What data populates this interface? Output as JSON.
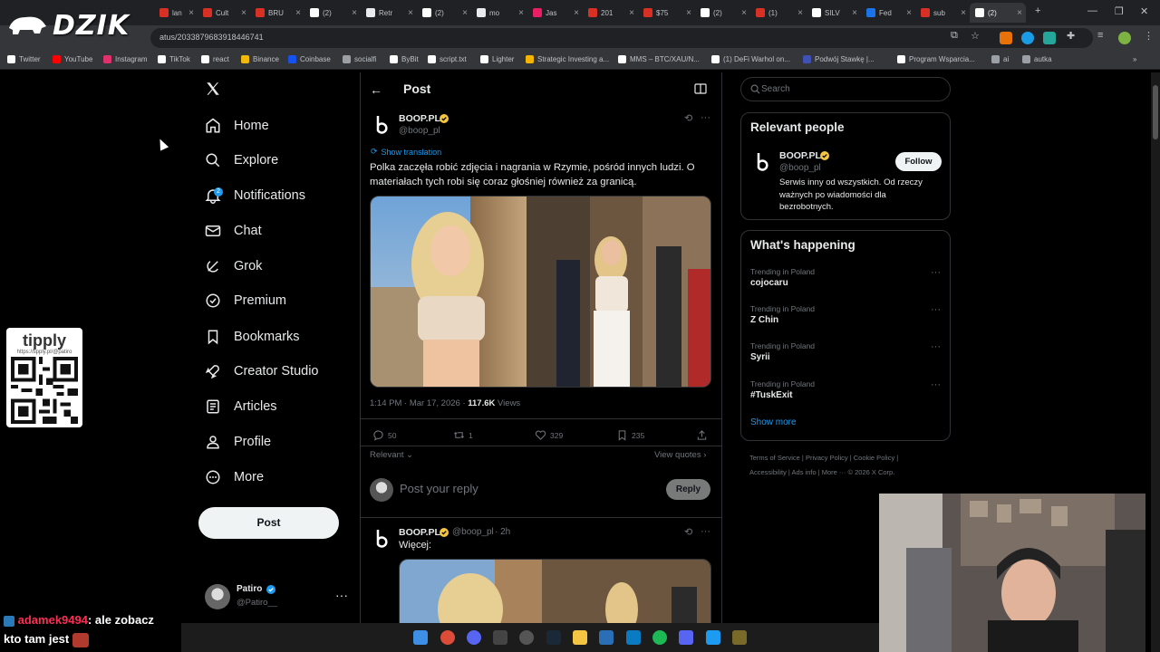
{
  "browser": {
    "tabs": [
      {
        "label": "lan",
        "color": "#d93025"
      },
      {
        "label": "Cult",
        "color": "#d93025"
      },
      {
        "label": "BRU",
        "color": "#d93025"
      },
      {
        "label": "(2)",
        "color": "#ffffff"
      },
      {
        "label": "Retr",
        "color": "#e8eaed"
      },
      {
        "label": "(2)",
        "color": "#ffffff"
      },
      {
        "label": "mo",
        "color": "#e8eaed"
      },
      {
        "label": "Jas",
        "color": "#e91e63"
      },
      {
        "label": "201",
        "color": "#d93025"
      },
      {
        "label": "$75",
        "color": "#d93025"
      },
      {
        "label": "(2)",
        "color": "#ffffff"
      },
      {
        "label": "(1)",
        "color": "#d93025"
      },
      {
        "label": "SILV",
        "color": "#ffffff"
      },
      {
        "label": "Fed",
        "color": "#1a73e8"
      },
      {
        "label": "sub",
        "color": "#d93025"
      },
      {
        "label": "(2)",
        "color": "#ffffff"
      }
    ],
    "url": "atus/2033879683918446741",
    "bookmarks": [
      {
        "label": "Twitter",
        "color": "#ffffff"
      },
      {
        "label": "YouTube",
        "color": "#ff0000"
      },
      {
        "label": "Instagram",
        "color": "#e1306c"
      },
      {
        "label": "TikTok",
        "color": "#ffffff"
      },
      {
        "label": "react",
        "color": "#ffffff"
      },
      {
        "label": "Binance",
        "color": "#f0b90b"
      },
      {
        "label": "Coinbase",
        "color": "#1652f0"
      },
      {
        "label": "socialfi",
        "color": "#9aa0a6"
      },
      {
        "label": "ByBit",
        "color": "#ffffff"
      },
      {
        "label": "script.txt",
        "color": "#ffffff"
      },
      {
        "label": "Lighter",
        "color": "#ffffff"
      },
      {
        "label": "Strategic Investing a...",
        "color": "#f4b400"
      },
      {
        "label": "MMS – BTC/XAU/N...",
        "color": "#ffffff"
      },
      {
        "label": "(1) DeFi Warhol on...",
        "color": "#ffffff"
      },
      {
        "label": "Podwój Stawkę |...",
        "color": "#3f51b5"
      },
      {
        "label": "Program Wsparcia...",
        "color": "#ffffff"
      },
      {
        "label": "ai",
        "color": "#9aa0a6"
      },
      {
        "label": "autka",
        "color": "#9aa0a6"
      }
    ]
  },
  "overlay": {
    "brand": "DZIK",
    "tipply_name": "tipply",
    "tipply_url": "https://tipply.pl/@patiro",
    "chat": [
      {
        "user": "adamek9494",
        "text": ": ale zobacz"
      },
      {
        "user": "",
        "text": "kto tam jest"
      }
    ]
  },
  "nav": {
    "items": [
      {
        "label": "Home",
        "icon": "home-icon"
      },
      {
        "label": "Explore",
        "icon": "search-icon"
      },
      {
        "label": "Notifications",
        "icon": "bell-icon",
        "badge": "2"
      },
      {
        "label": "Chat",
        "icon": "mail-icon"
      },
      {
        "label": "Grok",
        "icon": "grok-icon"
      },
      {
        "label": "Premium",
        "icon": "premium-icon"
      },
      {
        "label": "Bookmarks",
        "icon": "bookmark-icon"
      },
      {
        "label": "Creator Studio",
        "icon": "rocket-icon"
      },
      {
        "label": "Articles",
        "icon": "article-icon"
      },
      {
        "label": "Profile",
        "icon": "person-icon"
      },
      {
        "label": "More",
        "icon": "more-circle-icon"
      }
    ],
    "post_label": "Post",
    "account_name": "Patiro",
    "account_handle": "@Patiro__"
  },
  "post": {
    "header_title": "Post",
    "author_name": "BOOP.PL",
    "author_handle": "@boop_pl",
    "show_translation": "Show translation",
    "text": "Polka zaczęła robić zdjęcia i nagrania w Rzymie, pośród innych ludzi. O materiałach tych robi się coraz głośniej również za granicą.",
    "time": "1:14 PM · Mar 17, 2026 · ",
    "views_count": "117.6K",
    "views_label": " Views",
    "stats": {
      "replies": "50",
      "reposts": "1",
      "likes": "329",
      "bookmarks": "235"
    },
    "sort_label": "Relevant",
    "view_quotes": "View quotes",
    "reply_placeholder": "Post your reply",
    "reply_button": "Reply"
  },
  "reply": {
    "author_name": "BOOP.PL",
    "author_handle": "@boop_pl",
    "time": "· 2h",
    "text": "Więcej:"
  },
  "sidebar_right": {
    "search_placeholder": "Search",
    "relevant_title": "Relevant people",
    "person_name": "BOOP.PL",
    "person_handle": "@boop_pl",
    "follow_label": "Follow",
    "person_bio": "Serwis inny od wszystkich. Od rzeczy ważnych po wiadomości dla bezrobotnych.",
    "happening_title": "What's happening",
    "trends": [
      {
        "context": "Trending in Poland",
        "name": "cojocaru"
      },
      {
        "context": "Trending in Poland",
        "name": "Z Chin"
      },
      {
        "context": "Trending in Poland",
        "name": "Syrii"
      },
      {
        "context": "Trending in Poland",
        "name": "#TuskExit"
      }
    ],
    "show_more": "Show more",
    "footer_line1": "Terms of Service  |  Privacy Policy  |  Cookie Policy  |",
    "footer_line2": "Accessibility  |  Ads info  |  More ···  © 2026 X Corp."
  },
  "colors": {
    "accent": "#1d9bf0",
    "verified": "#f4c542",
    "background": "#000000",
    "border": "#2f3336"
  }
}
